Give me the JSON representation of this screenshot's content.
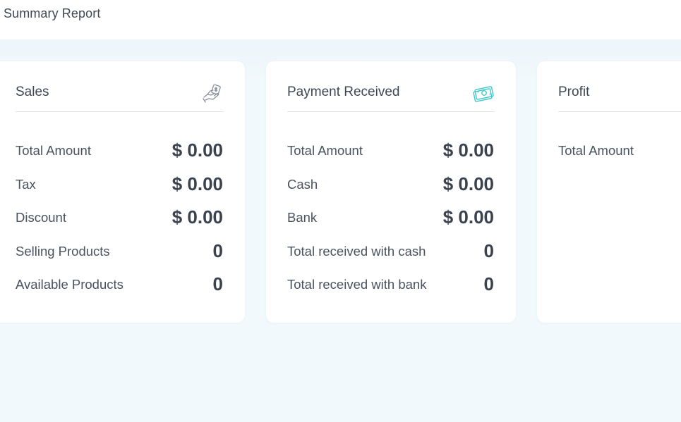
{
  "header": {
    "title": "Summary Report"
  },
  "colors": {
    "background": "#f2f9fd",
    "card": "#ffffff",
    "text": "#3f4754",
    "payment_icon": "#3cc8c8",
    "sales_icon": "#8a8f99"
  },
  "cards": {
    "sales": {
      "title": "Sales",
      "icon": "hand-coin-icon",
      "rows": [
        {
          "label": "Total Amount",
          "value": "$ 0.00"
        },
        {
          "label": "Tax",
          "value": "$ 0.00"
        },
        {
          "label": "Discount",
          "value": "$ 0.00"
        },
        {
          "label": "Selling Products",
          "value": "0"
        },
        {
          "label": "Available Products",
          "value": "0"
        }
      ]
    },
    "payment": {
      "title": "Payment Received",
      "icon": "money-bills-icon",
      "rows": [
        {
          "label": "Total Amount",
          "value": "$ 0.00"
        },
        {
          "label": "Cash",
          "value": "$ 0.00"
        },
        {
          "label": "Bank",
          "value": "$ 0.00"
        },
        {
          "label": "Total received with cash",
          "value": "0"
        },
        {
          "label": "Total received with bank",
          "value": "0"
        }
      ]
    },
    "profit": {
      "title": "Profit",
      "rows": [
        {
          "label": "Total Amount"
        }
      ]
    }
  }
}
